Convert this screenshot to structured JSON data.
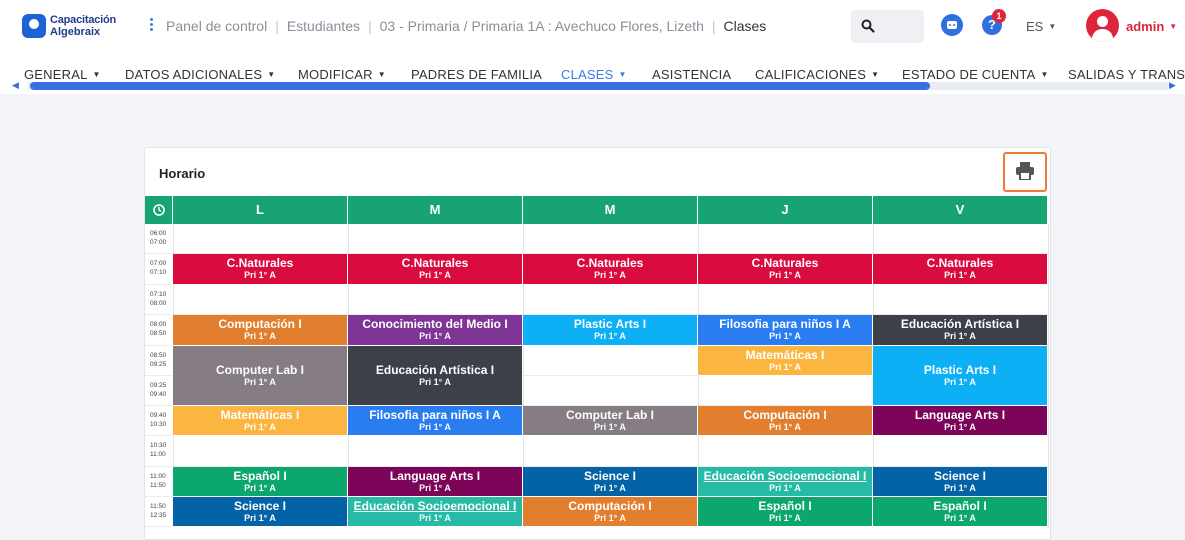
{
  "brand": {
    "line1": "Capacitación",
    "line2": "Algebraix"
  },
  "breadcrumb": {
    "items": [
      "Panel de control",
      "Estudiantes",
      "03 - Primaria / Primaria 1A : Avechuco Flores, Lizeth",
      "Clases"
    ]
  },
  "header": {
    "notif_count": "1",
    "language": "ES",
    "user": "admin"
  },
  "icons": {
    "search": "search-icon",
    "bot": "chatbot-icon",
    "help": "help-icon",
    "print": "printer-icon",
    "clock": "clock-icon"
  },
  "tabs": [
    {
      "label": "GENERAL",
      "dropdown": true,
      "active": false
    },
    {
      "label": "DATOS ADICIONALES",
      "dropdown": true,
      "active": false
    },
    {
      "label": "MODIFICAR",
      "dropdown": true,
      "active": false
    },
    {
      "label": "PADRES DE FAMILIA",
      "dropdown": false,
      "active": false
    },
    {
      "label": "CLASES",
      "dropdown": true,
      "active": true
    },
    {
      "label": "ASISTENCIA",
      "dropdown": false,
      "active": false
    },
    {
      "label": "CALIFICACIONES",
      "dropdown": true,
      "active": false
    },
    {
      "label": "ESTADO DE CUENTA",
      "dropdown": true,
      "active": false
    },
    {
      "label": "SALIDAS Y TRANS",
      "dropdown": false,
      "active": false
    }
  ],
  "card": {
    "title": "Horario"
  },
  "days": [
    "L",
    "M",
    "M",
    "J",
    "V"
  ],
  "times": [
    [
      "06:00",
      "07:00"
    ],
    [
      "07:00",
      "07:10"
    ],
    [
      "07:10",
      "08:00"
    ],
    [
      "08:00",
      "08:50"
    ],
    [
      "08:50",
      "09:25"
    ],
    [
      "09:25",
      "09:40"
    ],
    [
      "09:40",
      "10:30"
    ],
    [
      "10:30",
      "11:00"
    ],
    [
      "11:00",
      "11:50"
    ],
    [
      "11:50",
      "12:35"
    ]
  ],
  "colors": {
    "red": "#da0c3f",
    "orange": "#e27f2e",
    "purple": "#7e3596",
    "cyan": "#0db0f4",
    "blue": "#2a7df0",
    "dark": "#3e4049",
    "gray": "#857c84",
    "yellow": "#fbb641",
    "magenta": "#7c0559",
    "green": "#0ca66f",
    "navy": "#0463a6",
    "teal": "#25bba6",
    "header": "#17a372"
  },
  "group_label": "Pri 1° A",
  "classes": [
    {
      "day": 0,
      "start": 1,
      "span": 1,
      "name": "C.Naturales",
      "color": "red"
    },
    {
      "day": 1,
      "start": 1,
      "span": 1,
      "name": "C.Naturales",
      "color": "red"
    },
    {
      "day": 2,
      "start": 1,
      "span": 1,
      "name": "C.Naturales",
      "color": "red"
    },
    {
      "day": 3,
      "start": 1,
      "span": 1,
      "name": "C.Naturales",
      "color": "red"
    },
    {
      "day": 4,
      "start": 1,
      "span": 1,
      "name": "C.Naturales",
      "color": "red"
    },
    {
      "day": 0,
      "start": 3,
      "span": 1,
      "name": "Computación I",
      "color": "orange"
    },
    {
      "day": 1,
      "start": 3,
      "span": 1,
      "name": "Conocimiento del Medio I",
      "color": "purple"
    },
    {
      "day": 2,
      "start": 3,
      "span": 1,
      "name": "Plastic Arts I",
      "color": "cyan"
    },
    {
      "day": 3,
      "start": 3,
      "span": 1,
      "name": "Filosofia para niños I A",
      "color": "blue"
    },
    {
      "day": 4,
      "start": 3,
      "span": 1,
      "name": "Educación Artística I",
      "color": "dark"
    },
    {
      "day": 0,
      "start": 4,
      "span": 2,
      "name": "Computer Lab I",
      "color": "gray"
    },
    {
      "day": 1,
      "start": 4,
      "span": 2,
      "name": "Educación Artística I",
      "color": "dark"
    },
    {
      "day": 3,
      "start": 4,
      "span": 1,
      "name": "Matemáticas I",
      "color": "yellow"
    },
    {
      "day": 4,
      "start": 4,
      "span": 2,
      "name": "Plastic Arts I",
      "color": "cyan"
    },
    {
      "day": 0,
      "start": 6,
      "span": 1,
      "name": "Matemáticas I",
      "color": "yellow"
    },
    {
      "day": 1,
      "start": 6,
      "span": 1,
      "name": "Filosofia para niños I A",
      "color": "blue"
    },
    {
      "day": 2,
      "start": 6,
      "span": 1,
      "name": "Computer Lab I",
      "color": "gray"
    },
    {
      "day": 3,
      "start": 6,
      "span": 1,
      "name": "Computación I",
      "color": "orange"
    },
    {
      "day": 4,
      "start": 6,
      "span": 1,
      "name": "Language Arts I",
      "color": "magenta"
    },
    {
      "day": 0,
      "start": 8,
      "span": 1,
      "name": "Español I",
      "color": "green"
    },
    {
      "day": 1,
      "start": 8,
      "span": 1,
      "name": "Language Arts I",
      "color": "magenta"
    },
    {
      "day": 2,
      "start": 8,
      "span": 1,
      "name": "Science I",
      "color": "navy"
    },
    {
      "day": 3,
      "start": 8,
      "span": 1,
      "name": "Educación Socioemocional I",
      "color": "teal",
      "underline": true
    },
    {
      "day": 4,
      "start": 8,
      "span": 1,
      "name": "Science I",
      "color": "navy"
    },
    {
      "day": 0,
      "start": 9,
      "span": 1,
      "name": "Science I",
      "color": "navy"
    },
    {
      "day": 1,
      "start": 9,
      "span": 1,
      "name": "Educación Socioemocional I",
      "color": "teal",
      "underline": true
    },
    {
      "day": 2,
      "start": 9,
      "span": 1,
      "name": "Computación I",
      "color": "orange"
    },
    {
      "day": 3,
      "start": 9,
      "span": 1,
      "name": "Español I",
      "color": "green"
    },
    {
      "day": 4,
      "start": 9,
      "span": 1,
      "name": "Español I",
      "color": "green"
    }
  ]
}
